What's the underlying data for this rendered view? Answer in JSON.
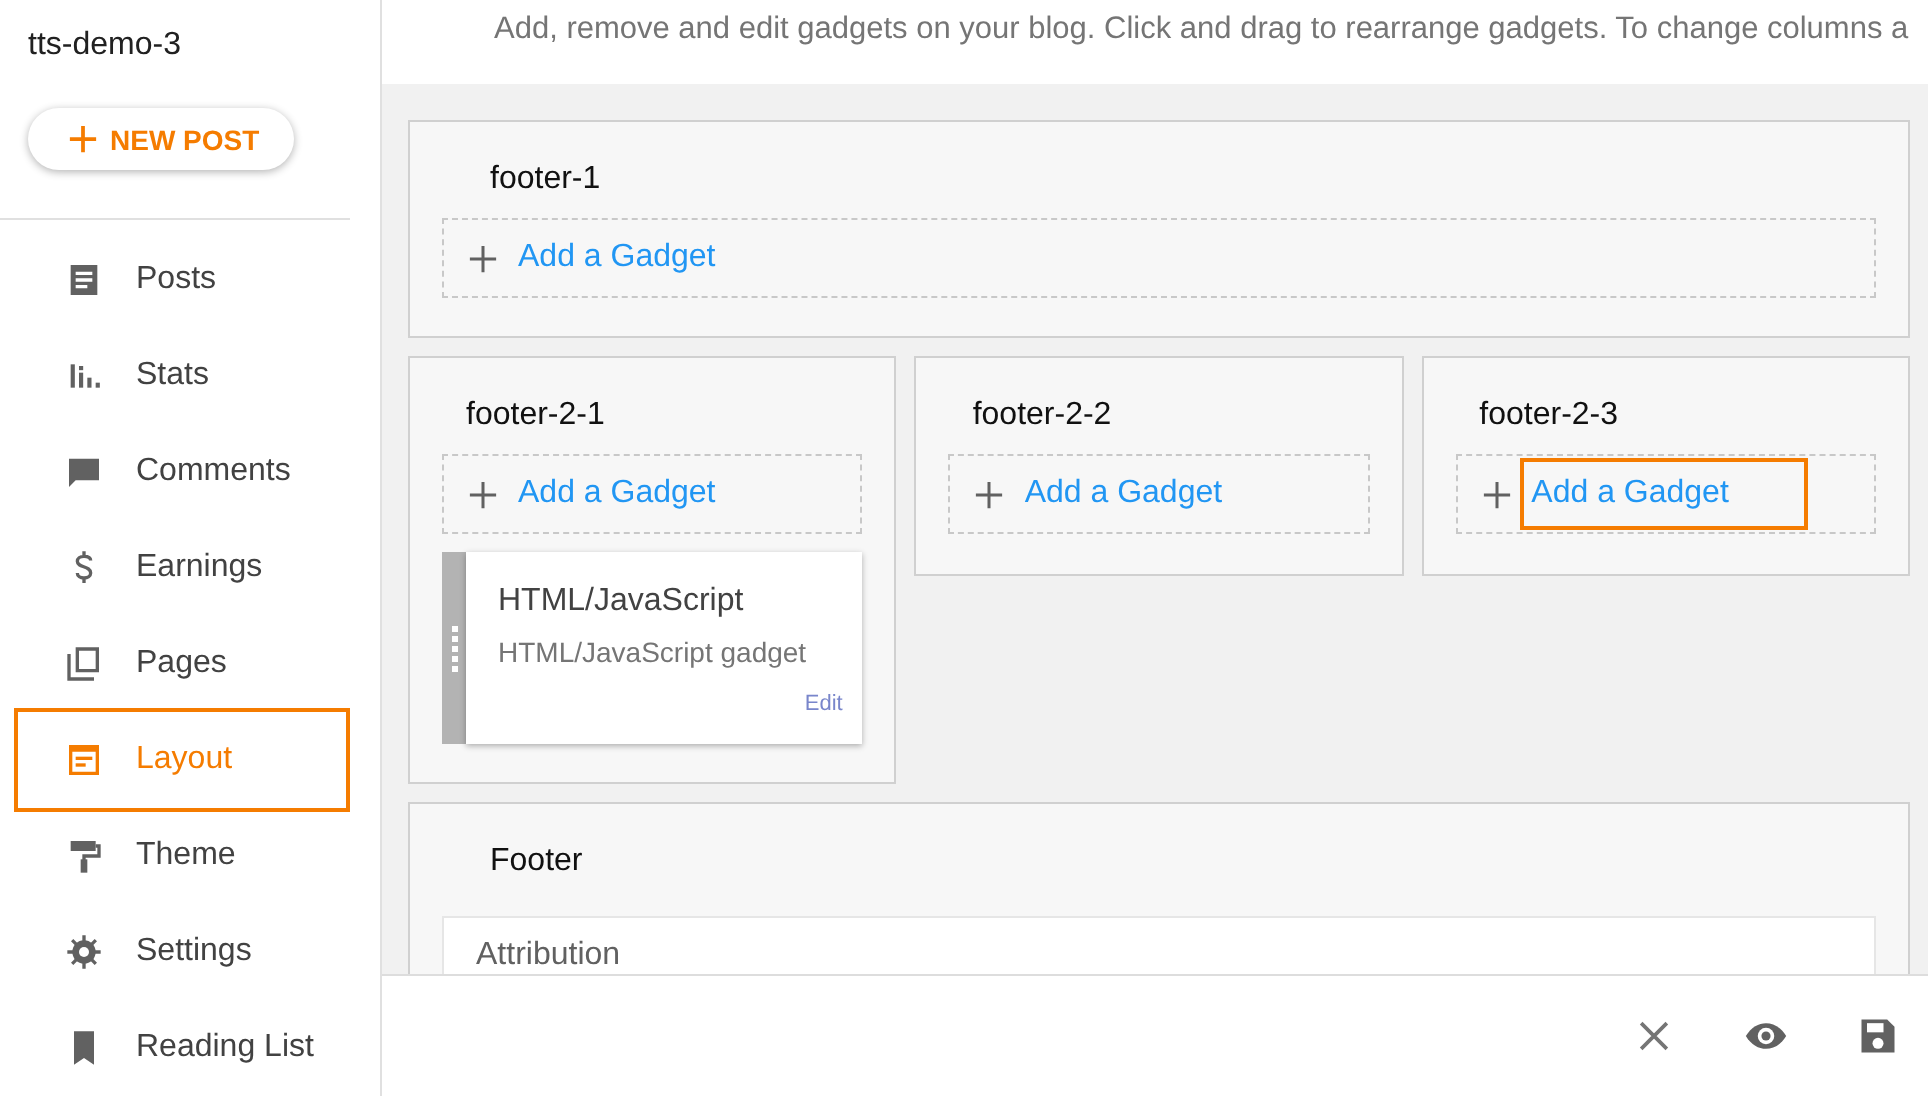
{
  "blog": {
    "title": "tts-demo-3"
  },
  "new_post": {
    "label": "NEW POST"
  },
  "nav": [
    {
      "kind": "posts",
      "label": "Posts",
      "selected": false,
      "highlighted": false
    },
    {
      "kind": "stats",
      "label": "Stats",
      "selected": false,
      "highlighted": false
    },
    {
      "kind": "comments",
      "label": "Comments",
      "selected": false,
      "highlighted": false
    },
    {
      "kind": "earnings",
      "label": "Earnings",
      "selected": false,
      "highlighted": false
    },
    {
      "kind": "pages",
      "label": "Pages",
      "selected": false,
      "highlighted": false
    },
    {
      "kind": "layout",
      "label": "Layout",
      "selected": true,
      "highlighted": true
    },
    {
      "kind": "theme",
      "label": "Theme",
      "selected": false,
      "highlighted": false
    },
    {
      "kind": "settings",
      "label": "Settings",
      "selected": false,
      "highlighted": false
    },
    {
      "kind": "reading-list",
      "label": "Reading List",
      "selected": false,
      "highlighted": false
    }
  ],
  "intro": "Add, remove and edit gadgets on your blog. Click and drag to rearrange gadgets. To change columns a",
  "footer_1": {
    "title": "footer-1",
    "add": {
      "label": "Add a Gadget",
      "highlighted": false
    }
  },
  "footer_2_columns": [
    {
      "title": "footer-2-1",
      "add": {
        "label": "Add a Gadget",
        "highlighted": false
      },
      "gadgets": [
        {
          "title": "HTML/JavaScript",
          "subtitle": "HTML/JavaScript gadget",
          "edit": "Edit"
        }
      ]
    },
    {
      "title": "footer-2-2",
      "add": {
        "label": "Add a Gadget",
        "highlighted": false
      }
    },
    {
      "title": "footer-2-3",
      "add": {
        "label": "Add a Gadget",
        "highlighted": true
      }
    }
  ],
  "footer": {
    "title": "Footer",
    "gadgets": [
      {
        "title": "Attribution"
      }
    ]
  }
}
